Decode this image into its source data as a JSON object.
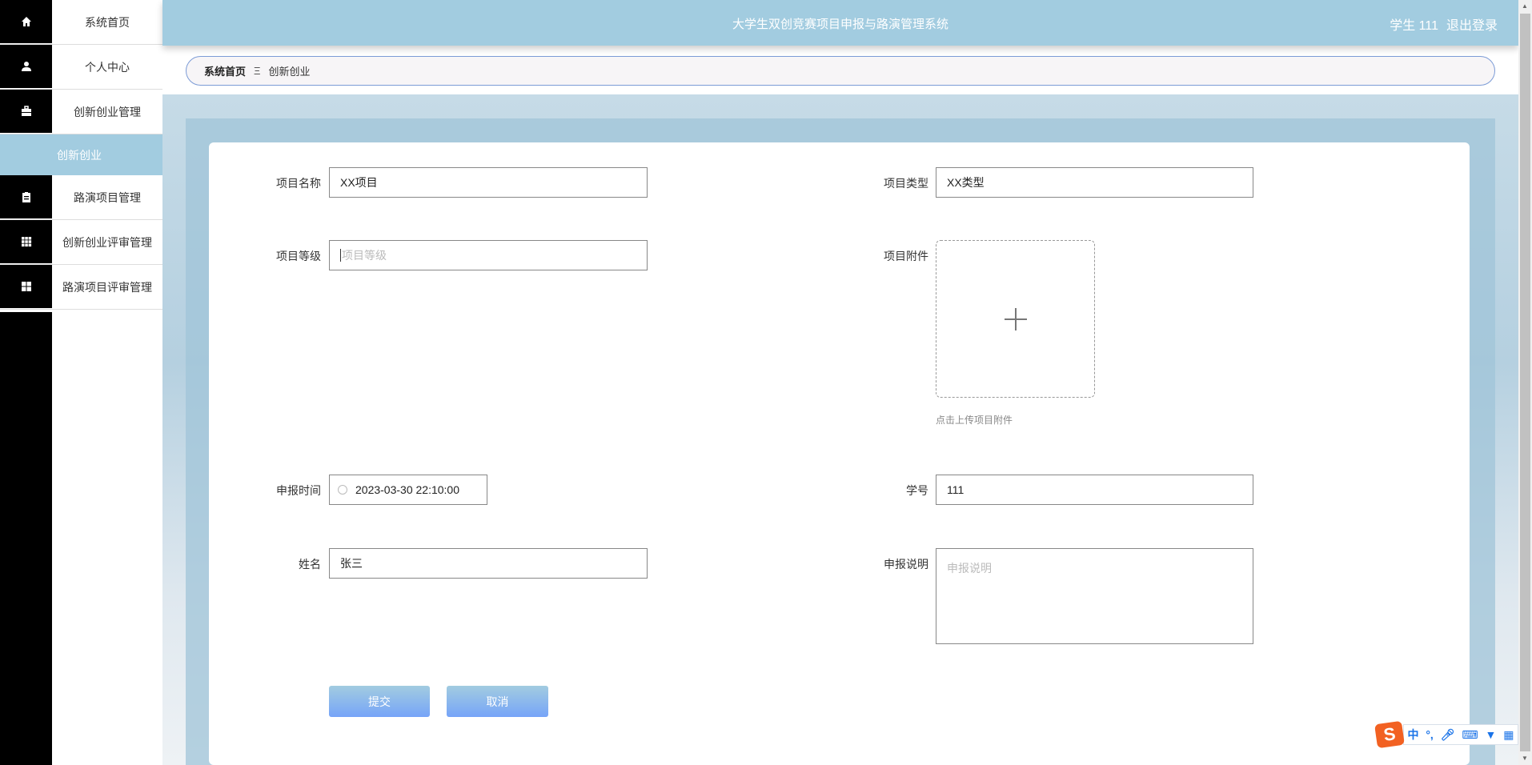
{
  "sidebar": {
    "items": [
      {
        "label": "系统首页",
        "icon": "home-icon"
      },
      {
        "label": "个人中心",
        "icon": "user-icon"
      },
      {
        "label": "创新创业管理",
        "icon": "briefcase-icon"
      },
      {
        "label": "创新创业",
        "active": true
      },
      {
        "label": "路演项目管理",
        "icon": "clipboard-icon"
      },
      {
        "label": "创新创业评审管理",
        "icon": "grid-icon"
      },
      {
        "label": "路演项目评审管理",
        "icon": "apps-icon"
      }
    ]
  },
  "header": {
    "title": "大学生双创竞赛项目申报与路演管理系统",
    "user": "学生 111",
    "logout": "退出登录"
  },
  "breadcrumb": {
    "home": "系统首页",
    "separator": "Ξ",
    "current": "创新创业"
  },
  "form": {
    "name": {
      "label": "项目名称",
      "value": "XX项目"
    },
    "type": {
      "label": "项目类型",
      "value": "XX类型"
    },
    "level": {
      "label": "项目等级",
      "placeholder": "项目等级"
    },
    "attachment": {
      "label": "项目附件",
      "hint": "点击上传项目附件"
    },
    "time": {
      "label": "申报时间",
      "value": "2023-03-30 22:10:00"
    },
    "student_no": {
      "label": "学号",
      "value": "111"
    },
    "student_name": {
      "label": "姓名",
      "value": "张三"
    },
    "desc": {
      "label": "申报说明",
      "placeholder": "申报说明"
    },
    "submit": "提交",
    "cancel": "取消"
  },
  "ime": {
    "logo": "S",
    "mode": "中",
    "punct": "°,"
  },
  "colors": {
    "accent": "#a2cce0",
    "button_bottom": "#76a4f8",
    "sidebar_icon_bg": "#000000"
  }
}
